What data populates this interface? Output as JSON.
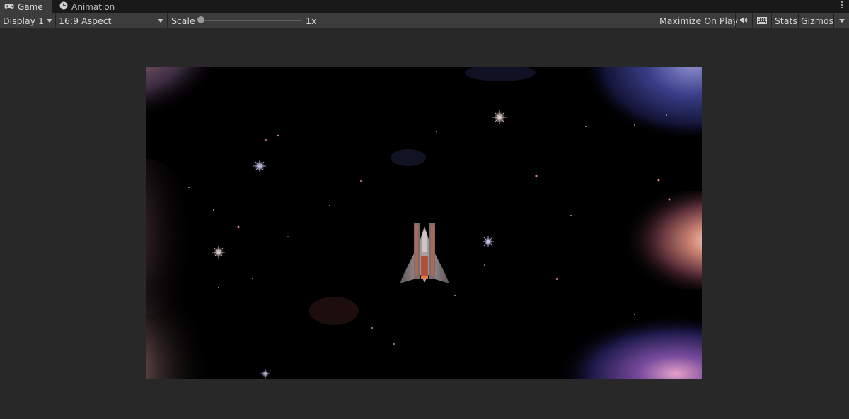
{
  "tabs": [
    {
      "label": "Game",
      "icon": "gamepad-icon",
      "active": true
    },
    {
      "label": "Animation",
      "icon": "clock-icon",
      "active": false
    }
  ],
  "toolbar": {
    "display_label": "Display 1",
    "aspect_label": "16:9 Aspect",
    "scale_label": "Scale",
    "scale_value": "1x",
    "maximize_label": "Maximize On Play",
    "stats_label": "Stats",
    "gizmos_label": "Gizmos"
  },
  "colors": {
    "editor_bg": "#282828",
    "toolbar_bg": "#3c3c3c",
    "tabbar_bg": "#191919",
    "game_bg": "#000000"
  }
}
